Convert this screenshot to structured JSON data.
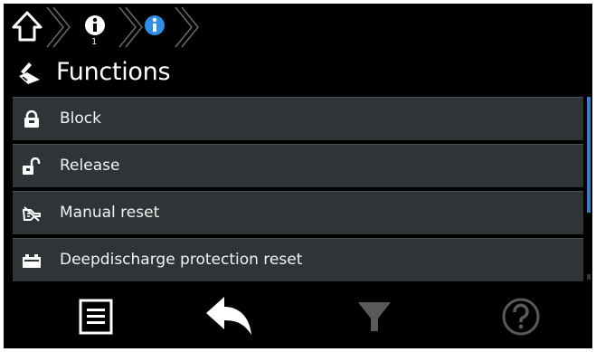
{
  "breadcrumb": {
    "items": [
      {
        "icon": "home-icon"
      },
      {
        "icon": "info-icon",
        "sub": "1"
      },
      {
        "icon": "info-icon-active"
      }
    ]
  },
  "title": {
    "icon": "functions-icon",
    "text": "Functions"
  },
  "list": {
    "items": [
      {
        "icon": "lock-closed-icon",
        "label": "Block"
      },
      {
        "icon": "lock-open-icon",
        "label": "Release"
      },
      {
        "icon": "manual-reset-icon",
        "label": "Manual reset"
      },
      {
        "icon": "battery-icon",
        "label": "Deepdischarge protection reset"
      }
    ]
  },
  "toolbar": {
    "buttons": [
      {
        "icon": "menu-list-icon"
      },
      {
        "icon": "back-arrow-icon"
      },
      {
        "icon": "filter-icon"
      },
      {
        "icon": "help-icon"
      }
    ]
  },
  "colors": {
    "background": "#000000",
    "row": "#2f3437",
    "accent": "#2f7fd8",
    "text": "#f2f2f2",
    "disabled": "#5a5a5a"
  }
}
